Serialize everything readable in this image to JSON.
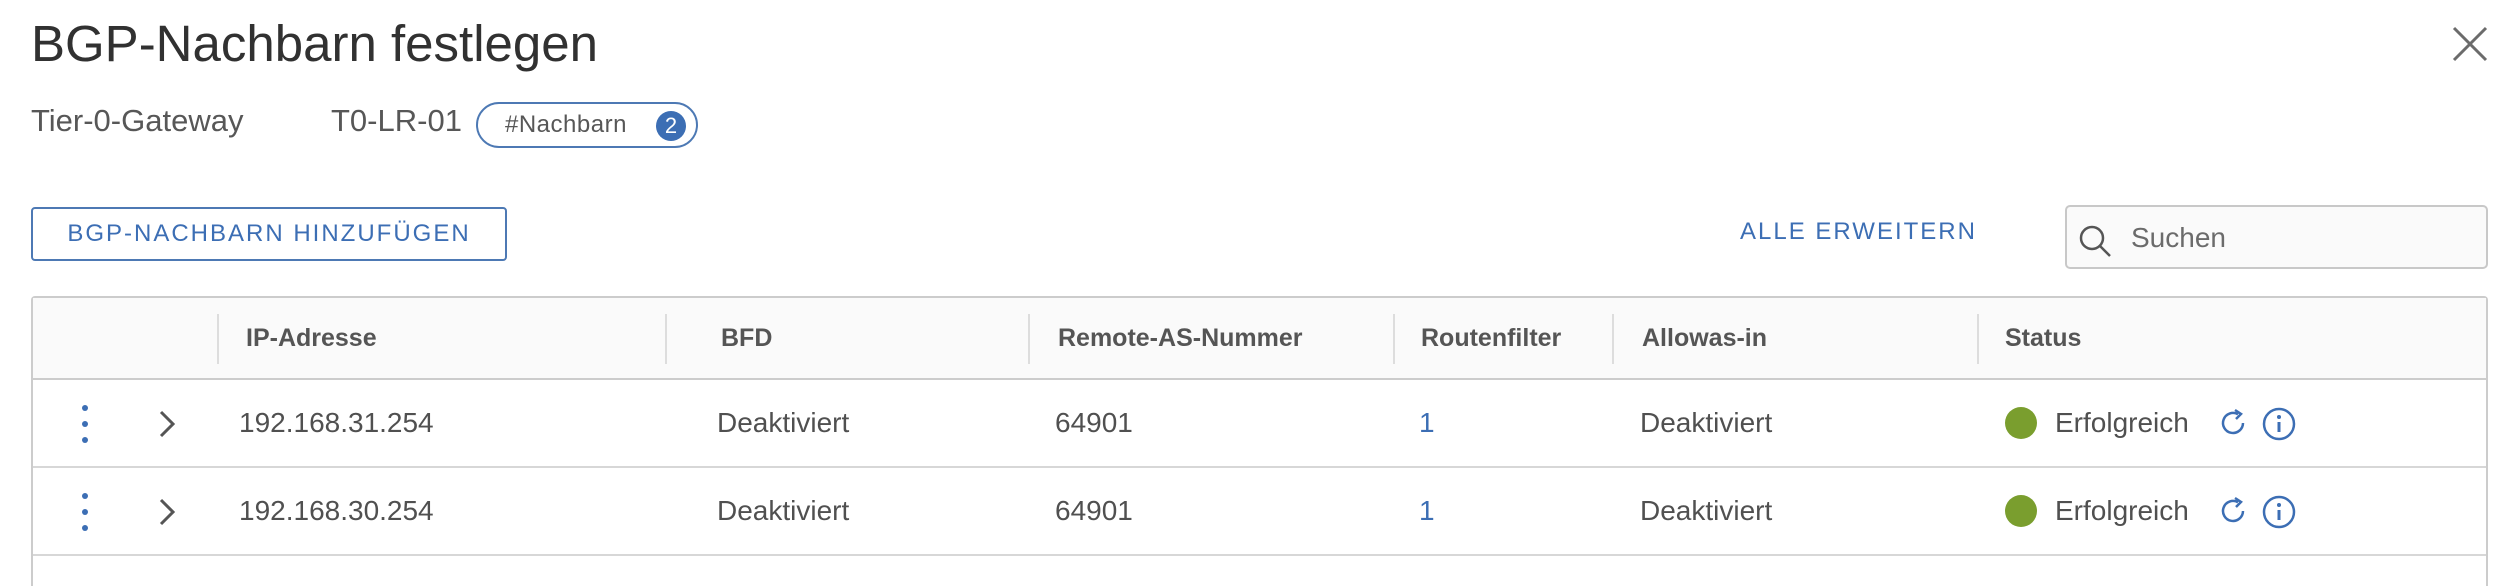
{
  "dialog": {
    "title": "BGP-Nachbarn festlegen",
    "gateway_label": "Tier-0-Gateway",
    "gateway_value": "T0-LR-01",
    "chip_label": "#Nachbarn",
    "chip_count": "2"
  },
  "toolbar": {
    "add_label": "BGP-NACHBARN HINZUFÜGEN",
    "expand_label": "ALLE ERWEITERN",
    "search_placeholder": "Suchen"
  },
  "table": {
    "columns": [
      "IP-Adresse",
      "BFD",
      "Remote-AS-Nummer",
      "Routenfilter",
      "Allowas-in",
      "Status"
    ],
    "rows": [
      {
        "ip": "192.168.31.254",
        "bfd": "Deaktiviert",
        "remote_as": "64901",
        "route_filter": "1",
        "allowas_in": "Deaktiviert",
        "status": "Erfolgreich"
      },
      {
        "ip": "192.168.30.254",
        "bfd": "Deaktiviert",
        "remote_as": "64901",
        "route_filter": "1",
        "allowas_in": "Deaktiviert",
        "status": "Erfolgreich"
      }
    ]
  },
  "colors": {
    "accent": "#3c6eb4",
    "status_success": "#7a9e2e",
    "border": "#cccccc"
  },
  "icons": [
    "close-icon",
    "search-icon",
    "kebab-menu-icon",
    "chevron-right-icon",
    "status-dot-icon",
    "refresh-icon",
    "info-icon"
  ]
}
